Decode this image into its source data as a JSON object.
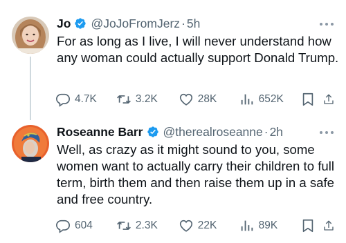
{
  "tweets": [
    {
      "name": "Jo",
      "handle": "@JoJoFromJerz",
      "separator": "·",
      "time": "5h",
      "text": "For as long as I live, I will never understand how any woman could actually support Donald Trump.",
      "replies": "4.7K",
      "retweets": "3.2K",
      "likes": "28K",
      "views": "652K"
    },
    {
      "name": "Roseanne Barr",
      "handle": "@therealroseanne",
      "separator": "·",
      "time": "2h",
      "text": "Well, as crazy as it might sound to you, some women want to actually carry their children to full term, birth them and then raise them up in a safe and free country.",
      "replies": "604",
      "retweets": "2.3K",
      "likes": "22K",
      "views": "89K"
    }
  ],
  "icons": {
    "verified": "verified-badge-icon",
    "more": "more-dots-icon",
    "reply": "reply-icon",
    "retweet": "retweet-icon",
    "like": "heart-icon",
    "views": "views-chart-icon",
    "bookmark": "bookmark-icon",
    "share": "share-icon"
  },
  "colors": {
    "verified_blue": "#1d9bf0",
    "secondary_text": "#536471",
    "primary_text": "#0f1419",
    "thread_line": "#cfd9de"
  }
}
